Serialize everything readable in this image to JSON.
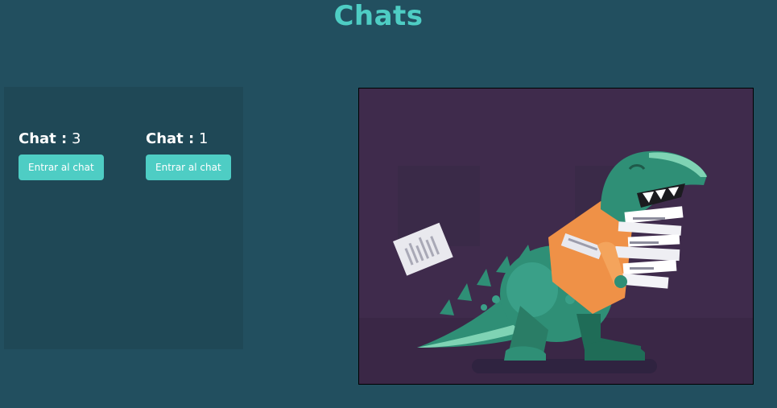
{
  "header": {
    "title": "Chats"
  },
  "chats": [
    {
      "label": "Chat :",
      "number": "3",
      "button_label": "Entrar al chat"
    },
    {
      "label": "Chat :",
      "number": "1",
      "button_label": "Entrar al chat"
    }
  ],
  "illustration": {
    "subject": "dinosaur carrying stack of papers",
    "colors": {
      "background": "#3f2b4c",
      "dino": "#2f8f76",
      "vest": "#ef9147"
    }
  },
  "colors": {
    "page_background": "#224f5f",
    "panel_background": "#1f4856",
    "accent": "#4ecdc4"
  }
}
